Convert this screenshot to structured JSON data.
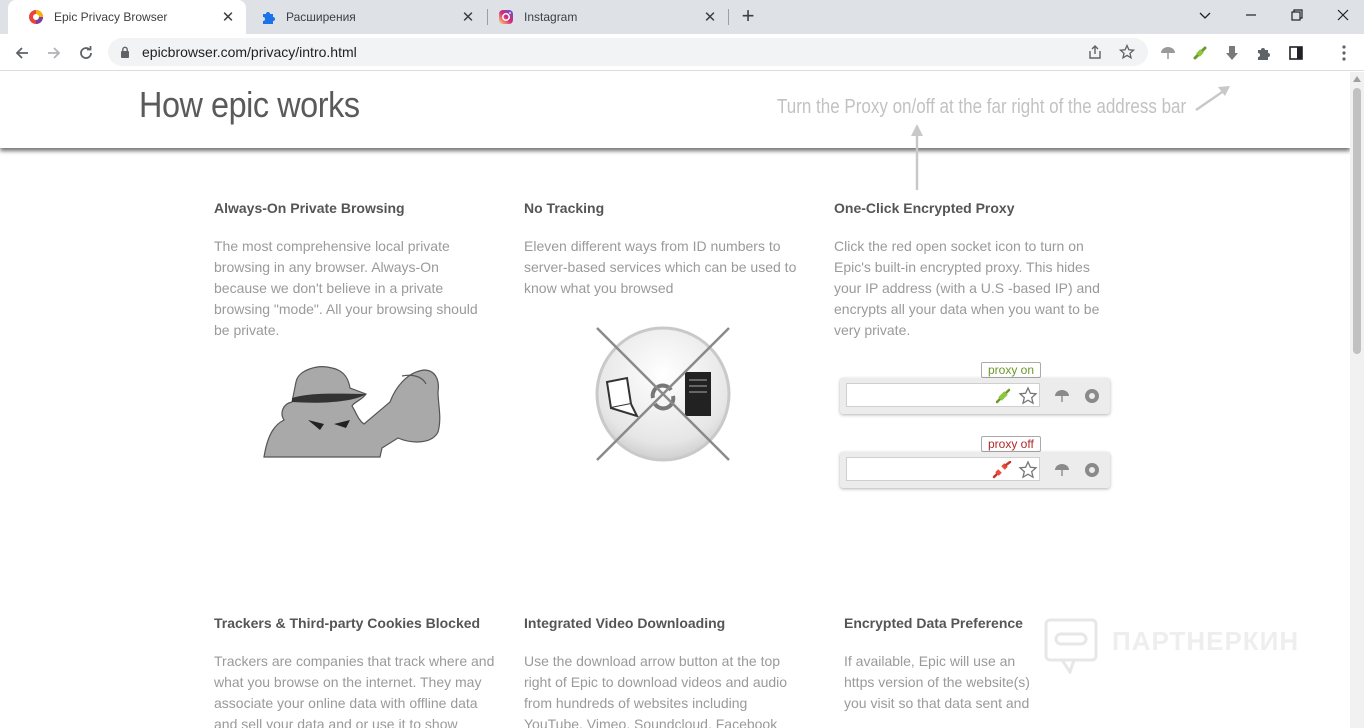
{
  "tabs": [
    {
      "title": "Epic Privacy Browser",
      "active": true
    },
    {
      "title": "Расширения",
      "active": false
    },
    {
      "title": "Instagram",
      "active": false
    }
  ],
  "toolbar": {
    "url": "epicbrowser.com/privacy/intro.html"
  },
  "hero": {
    "title": "How epic works",
    "hint": "Turn the Proxy on/off at the far right of the address bar"
  },
  "features": [
    {
      "title": "Always-On Private Browsing",
      "text": "The most comprehensive local private browsing in any browser. Always-On because we don't believe in a private browsing \"mode\". All your browsing should be private."
    },
    {
      "title": "No Tracking",
      "text": "Eleven different ways from ID numbers to server-based services which can be used to know what you browsed"
    },
    {
      "title": "One-Click Encrypted Proxy",
      "text": "Click the red open socket icon to turn on Epic's built-in encrypted proxy. This hides your IP address (with a U.S -based IP) and encrypts all your data when you want to be very private."
    },
    {
      "title": "Trackers & Third-party Cookies Blocked",
      "text": "Trackers are companies that track where and what you browse on the internet. They may associate your online data with offline data and sell your data and or use it to show"
    },
    {
      "title": "Integrated Video Downloading",
      "text": "Use the download arrow button at the top right of Epic to download videos and audio from hundreds of websites including YouTube, Vimeo, Soundcloud, Facebook"
    },
    {
      "title": "Encrypted Data Preference",
      "text": "If available, Epic will use an https version of the website(s) you visit so that data sent and"
    }
  ],
  "proxy_demo": {
    "on_label": "proxy on",
    "off_label": "proxy off"
  },
  "watermark": "ПАРТНЕРКИН",
  "colors": {
    "proxy_on": "#6a9a2a",
    "proxy_off": "#c0392b",
    "tabstrip": "#dee1e6"
  }
}
